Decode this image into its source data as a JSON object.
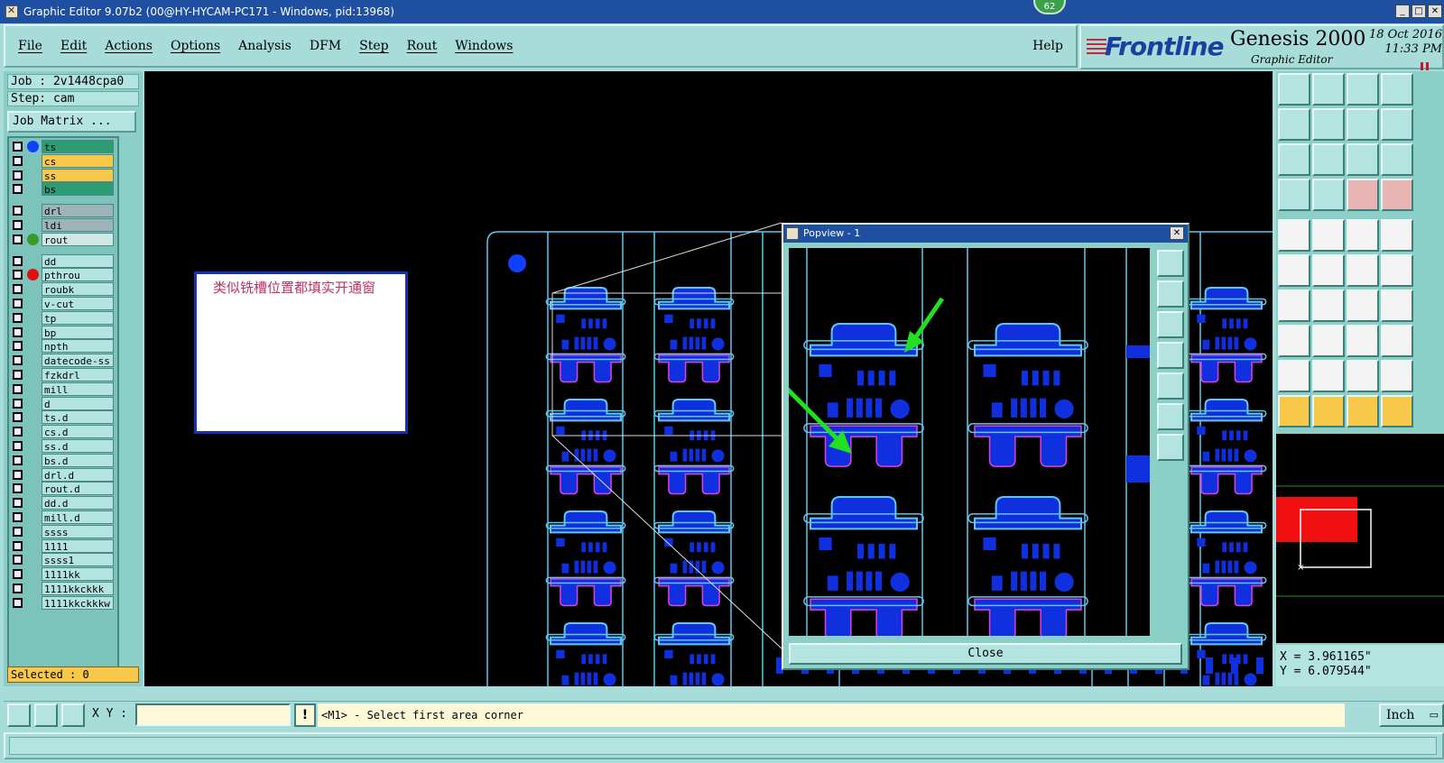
{
  "window": {
    "title": "Graphic Editor 9.07b2 (00@HY-HYCAM-PC171 - Windows, pid:13968)",
    "notification_count": "62"
  },
  "menu": {
    "items": [
      "File",
      "Edit",
      "Actions",
      "Options",
      "Analysis",
      "DFM",
      "Step",
      "Rout",
      "Windows"
    ],
    "help": "Help"
  },
  "branding": {
    "brand": "Frontline",
    "product": "Genesis 2000",
    "subtitle": "Graphic Editor",
    "date": "18 Oct 2016",
    "time": "11:33 PM"
  },
  "job": {
    "job_label": "Job : 2v1448cpa0",
    "step_label": "Step: cam",
    "matrix_button": "Job Matrix ..."
  },
  "layers": [
    {
      "name": "ts",
      "color": "#2e9c72",
      "dot": "#1040ff"
    },
    {
      "name": "cs",
      "color": "#f8c84a",
      "dot": ""
    },
    {
      "name": "ss",
      "color": "#f8c84a",
      "dot": ""
    },
    {
      "name": "bs",
      "color": "#2e9c72",
      "dot": ""
    },
    {
      "name": "drl",
      "color": "#9cb4b8",
      "dot": ""
    },
    {
      "name": "ldi",
      "color": "#9cb4b8",
      "dot": ""
    },
    {
      "name": "rout",
      "color": "#d0e8e4",
      "dot": "#3a9a2a"
    },
    {
      "name": "dd",
      "color": "#b4e4df",
      "dot": ""
    },
    {
      "name": "pthrou",
      "color": "#b4e4df",
      "dot": "#e01010"
    },
    {
      "name": "roubk",
      "color": "#b4e4df",
      "dot": ""
    },
    {
      "name": "v-cut",
      "color": "#b4e4df",
      "dot": ""
    },
    {
      "name": "tp",
      "color": "#b4e4df",
      "dot": ""
    },
    {
      "name": "bp",
      "color": "#b4e4df",
      "dot": ""
    },
    {
      "name": "npth",
      "color": "#b4e4df",
      "dot": ""
    },
    {
      "name": "datecode-ss",
      "color": "#b4e4df",
      "dot": ""
    },
    {
      "name": "fzkdrl",
      "color": "#b4e4df",
      "dot": ""
    },
    {
      "name": "mill",
      "color": "#b4e4df",
      "dot": ""
    },
    {
      "name": "d",
      "color": "#b4e4df",
      "dot": ""
    },
    {
      "name": "ts.d",
      "color": "#b4e4df",
      "dot": ""
    },
    {
      "name": "cs.d",
      "color": "#b4e4df",
      "dot": ""
    },
    {
      "name": "ss.d",
      "color": "#b4e4df",
      "dot": ""
    },
    {
      "name": "bs.d",
      "color": "#b4e4df",
      "dot": ""
    },
    {
      "name": "drl.d",
      "color": "#b4e4df",
      "dot": ""
    },
    {
      "name": "rout.d",
      "color": "#b4e4df",
      "dot": ""
    },
    {
      "name": "dd.d",
      "color": "#b4e4df",
      "dot": ""
    },
    {
      "name": "mill.d",
      "color": "#b4e4df",
      "dot": ""
    },
    {
      "name": "ssss",
      "color": "#b4e4df",
      "dot": ""
    },
    {
      "name": "1111",
      "color": "#b4e4df",
      "dot": ""
    },
    {
      "name": "ssss1",
      "color": "#b4e4df",
      "dot": ""
    },
    {
      "name": "1111kk",
      "color": "#b4e4df",
      "dot": ""
    },
    {
      "name": "1111kkckkk",
      "color": "#b4e4df",
      "dot": ""
    },
    {
      "name": "1111kkckkkw",
      "color": "#b4e4df",
      "dot": ""
    }
  ],
  "selection": {
    "label": "Selected : 0"
  },
  "note": {
    "text": "类似铣槽位置都填实开通窗"
  },
  "popview": {
    "title": "Popview - 1",
    "close_label": "Close"
  },
  "coordinates": {
    "x": "X = 3.961165\"",
    "y": "Y = 6.079544\""
  },
  "bottom": {
    "xy_label": "X Y :",
    "xy_value": "",
    "warn": "!",
    "message": "<M1> - Select first area corner",
    "units": "Inch"
  },
  "colors": {
    "pad": "#1030e0",
    "outline": "#60c8f0",
    "highlight": "#e040e0",
    "arrow": "#20e020"
  }
}
